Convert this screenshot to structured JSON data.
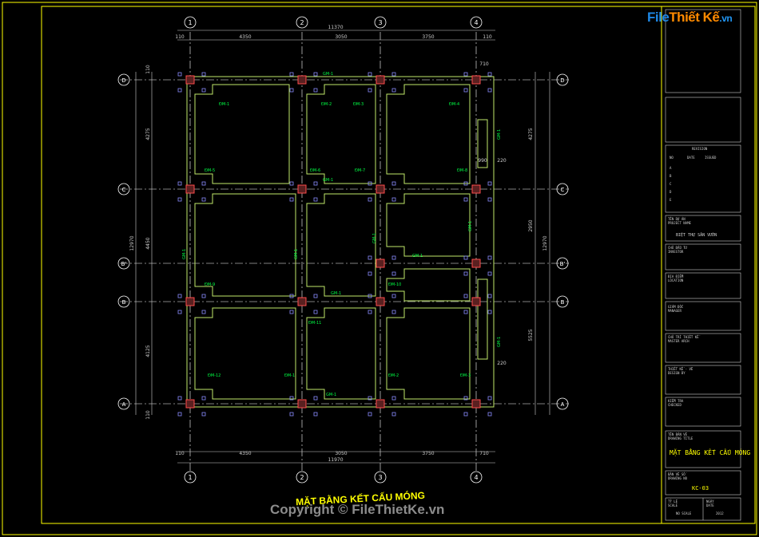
{
  "logo": {
    "part1": "File",
    "part2": "Thiết Kế",
    ".vn": ".vn"
  },
  "copyright": "Copyright © FileThietKe.vn",
  "drawing_title": "MẶT BẰNG KẾT CẤU MÓNG",
  "grid": {
    "cols": [
      "1",
      "2",
      "3",
      "4"
    ],
    "rows": [
      "D",
      "C",
      "B'",
      "B",
      "A"
    ]
  },
  "dims": {
    "top_total": "11370",
    "top_parts": [
      "110",
      "4350",
      "3050",
      "3750",
      "110"
    ],
    "top_extra": "710",
    "bottom_total": "11970",
    "bottom_parts": [
      "110",
      "4350",
      "3050",
      "3750",
      "710"
    ],
    "left_total": "12970",
    "left_parts": [
      "110",
      "4275",
      "4450",
      "4125",
      "110"
    ],
    "right_total": "12970",
    "right_parts": [
      "4275",
      "2950",
      "5525"
    ],
    "misc": [
      "990",
      "220",
      "220"
    ]
  },
  "labels": {
    "gm": "GM-1",
    "dm": [
      "ĐM-1",
      "ĐM-2",
      "ĐM-3",
      "ĐM-4",
      "ĐM-5",
      "ĐM-6",
      "ĐM-7",
      "ĐM-8",
      "ĐM-9",
      "ĐM-10",
      "ĐM-11",
      "ĐM-12"
    ]
  },
  "title_block": {
    "revision": "REVISION",
    "rev_cols": [
      "NO",
      "DATE",
      "ISSUED"
    ],
    "rev_rows": [
      "A",
      "B",
      "C",
      "D",
      "E"
    ],
    "project_label": "TÊN DỰ ÁN",
    "project_sub": "PROJECT NAME",
    "project_name": "BIỆT THỰ SÂN VƯỜN",
    "owner_label": "CHỦ ĐẦU TƯ",
    "owner_sub": "INVESTOR",
    "location_label": "ĐỊA ĐIỂM",
    "location_sub": "LOCATION",
    "design_label": "GIÁM ĐỐC",
    "design_sub": "MANAGER",
    "chief_label": "CHỦ TRÌ THIẾT KẾ",
    "chief_sub": "MASTER ARCH",
    "drawn_label": "THIẾT KẾ - VẼ",
    "drawn_sub": "DESIGN BY",
    "check_label": "KIỂM TRA",
    "check_sub": "CHECKED",
    "sheet_label": "TÊN BẢN VẼ",
    "sheet_sub": "DRAWING TITLE",
    "sheet_title": "MẶT BẰNG KẾT CẤU MÓNG",
    "no_label": "BẢN VẼ SỐ",
    "no_sub": "DRAWING NO",
    "sheet_no": "KC-03",
    "scale_label": "TỶ LỆ",
    "scale_sub": "SCALE",
    "scale_val": "NO SCALE",
    "date_label": "NGÀY",
    "date_sub": "DATE",
    "date_val": "2012"
  },
  "colors": {
    "frame": "#ffff00",
    "wall": "#bfe86a",
    "grid": "#ffffff",
    "column": "#ff4d4d",
    "footing": "#8a8cff",
    "dim": "#cfcfcf",
    "text_green": "#00ff44"
  }
}
